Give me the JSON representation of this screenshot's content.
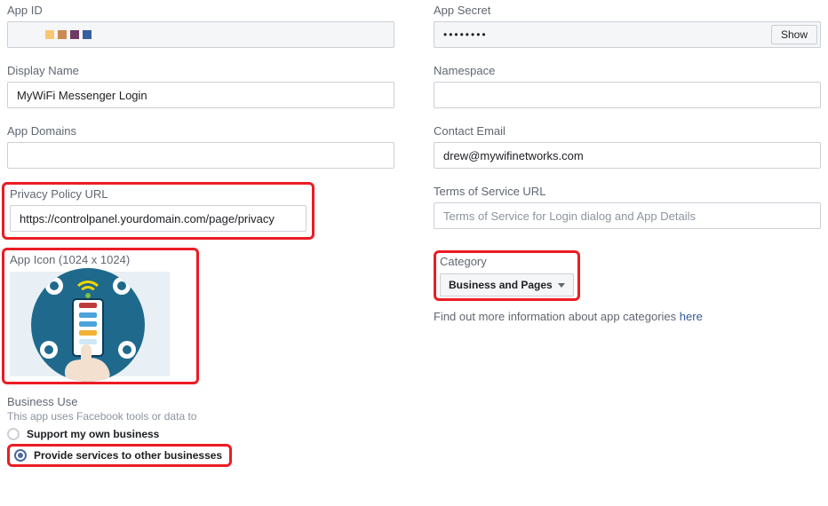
{
  "app_id": {
    "label": "App ID"
  },
  "app_secret": {
    "label": "App Secret",
    "masked": "••••••••",
    "show_btn": "Show"
  },
  "display_name": {
    "label": "Display Name",
    "value": "MyWiFi Messenger Login"
  },
  "namespace": {
    "label": "Namespace",
    "value": ""
  },
  "app_domains": {
    "label": "App Domains",
    "value": ""
  },
  "contact_email": {
    "label": "Contact Email",
    "value": "drew@mywifinetworks.com"
  },
  "privacy": {
    "label": "Privacy Policy URL",
    "value": "https://controlpanel.yourdomain.com/page/privacy"
  },
  "tos": {
    "label": "Terms of Service URL",
    "placeholder": "Terms of Service for Login dialog and App Details",
    "value": ""
  },
  "app_icon": {
    "label": "App Icon (1024 x 1024)"
  },
  "category": {
    "label": "Category",
    "selected": "Business and Pages",
    "hint_prefix": "Find out more information about app categories ",
    "hint_link": "here"
  },
  "business_use": {
    "label": "Business Use",
    "sub": "This app uses Facebook tools or data to",
    "opt1": "Support my own business",
    "opt2": "Provide services to other businesses",
    "selected": 2
  }
}
